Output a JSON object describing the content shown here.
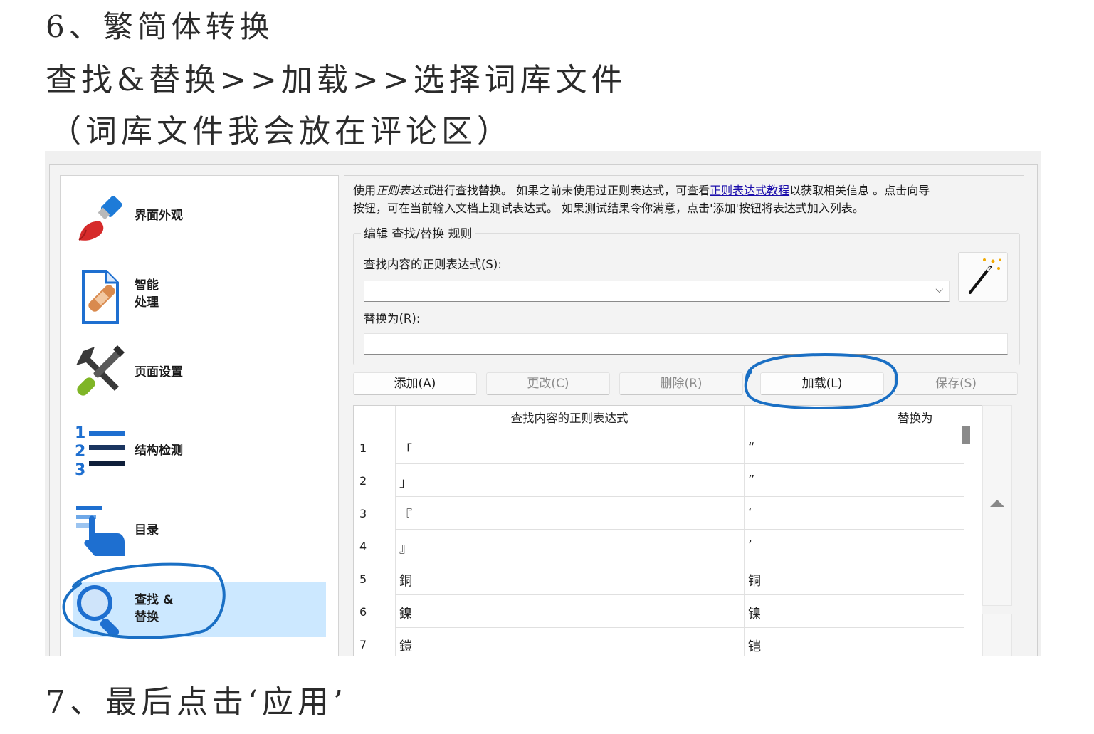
{
  "notes": {
    "step6_title": "6、繁简体转换",
    "step6_path": "查找&替换>>加载>>选择词库文件",
    "step6_remark": "（词库文件我会放在评论区）",
    "step7": "7、最后点击‘应用’"
  },
  "sidebar": {
    "items": [
      {
        "label": "界面外观",
        "icon": "paintbrush-icon"
      },
      {
        "label": "智能\n处理",
        "icon": "bandage-document-icon"
      },
      {
        "label": "页面设置",
        "icon": "tools-icon"
      },
      {
        "label": "结构检测",
        "icon": "numbered-list-icon"
      },
      {
        "label": "目录",
        "icon": "toc-hand-icon"
      },
      {
        "label": "查找 &\n替换",
        "icon": "magnifier-icon",
        "selected": true
      }
    ]
  },
  "description": {
    "part1": "使用",
    "italic": "正则表达式",
    "part2": "进行查找替换。 如果之前未使用过正则表达式，可查看",
    "link": "正则表达式教程",
    "part3": "以获取相关信息 。点击向导",
    "line2": "按钮，可在当前输入文档上测试表达式。 如果测试结果令你满意，点击'添加'按钮将表达式加入列表。"
  },
  "editor": {
    "group_title": "编辑 查找/替换 规则",
    "find_label": "查找内容的正则表达式(S):",
    "find_value": "",
    "replace_label": "替换为(R):",
    "replace_value": ""
  },
  "buttons": {
    "add": "添加(A)",
    "modify": "更改(C)",
    "delete": "删除(R)",
    "load": "加载(L)",
    "save": "保存(S)"
  },
  "table": {
    "headers": [
      "查找内容的正则表达式",
      "替换为"
    ],
    "rows": [
      {
        "n": "1",
        "find": "「",
        "replace": "“"
      },
      {
        "n": "2",
        "find": "」",
        "replace": "”"
      },
      {
        "n": "3",
        "find": "『",
        "replace": "‘"
      },
      {
        "n": "4",
        "find": "』",
        "replace": "’"
      },
      {
        "n": "5",
        "find": "銅",
        "replace": "铜"
      },
      {
        "n": "6",
        "find": "鎳",
        "replace": "镍"
      },
      {
        "n": "7",
        "find": "鎧",
        "replace": "铠"
      }
    ]
  },
  "colors": {
    "accent_circle": "#1a6fc4",
    "selected_bg": "#cce8ff",
    "link": "#1a0dab"
  }
}
